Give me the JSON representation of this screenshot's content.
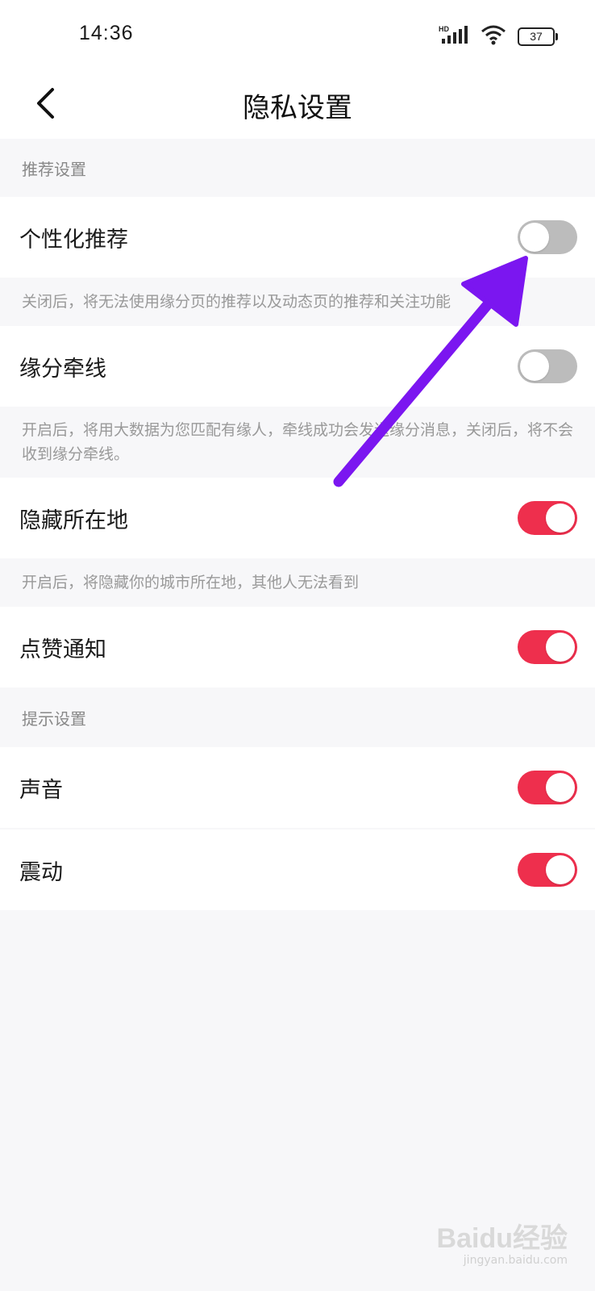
{
  "status": {
    "time": "14:36",
    "network": "HD",
    "battery": "37"
  },
  "header": {
    "back_icon": "chevron-left-icon",
    "title": "隐私设置"
  },
  "sections": {
    "recommend_header": "推荐设置",
    "prompt_header": "提示设置"
  },
  "items": {
    "personalized": {
      "label": "个性化推荐",
      "on": false
    },
    "personalized_desc": "关闭后，将无法使用缘分页的推荐以及动态页的推荐和关注功能",
    "fate_line": {
      "label": "缘分牵线",
      "on": false
    },
    "fate_line_desc": "开启后，将用大数据为您匹配有缘人，牵线成功会发送缘分消息，关闭后，将不会收到缘分牵线。",
    "hide_location": {
      "label": "隐藏所在地",
      "on": true
    },
    "hide_location_desc": "开启后，将隐藏你的城市所在地，其他人无法看到",
    "like_notify": {
      "label": "点赞通知",
      "on": true
    },
    "sound": {
      "label": "声音",
      "on": true
    },
    "vibrate": {
      "label": "震动",
      "on": true
    }
  },
  "colors": {
    "toggle_on": "#ee2f4d",
    "toggle_off": "#bcbcbc",
    "annotation_arrow": "#7b16f0"
  },
  "watermark": {
    "main": "Baidu经验",
    "sub": "jingyan.baidu.com"
  }
}
